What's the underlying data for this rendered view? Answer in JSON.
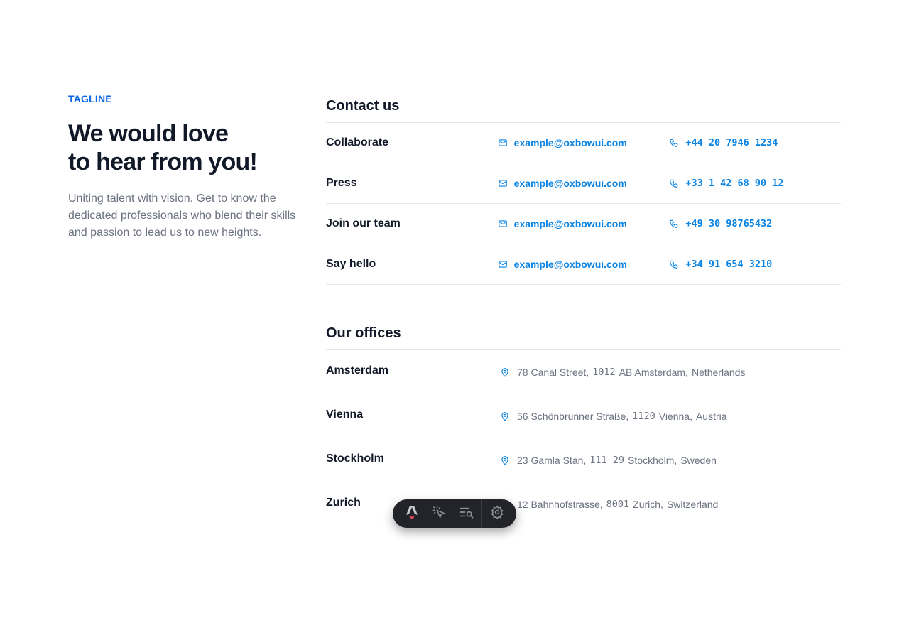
{
  "hero": {
    "tagline": "TAGLINE",
    "headline_line1": "We would love",
    "headline_line2": "to hear from you!",
    "intro": "Uniting talent with vision. Get to know the dedicated professionals who blend their skills and passion to lead us to new heights."
  },
  "contact": {
    "title": "Contact us",
    "rows": [
      {
        "label": "Collaborate",
        "email": "example@oxbowui.com",
        "phone": "+44 20 7946 1234"
      },
      {
        "label": "Press",
        "email": "example@oxbowui.com",
        "phone": "+33 1 42 68 90 12"
      },
      {
        "label": "Join our team",
        "email": "example@oxbowui.com",
        "phone": "+49 30 98765432"
      },
      {
        "label": "Say hello",
        "email": "example@oxbowui.com",
        "phone": "+34 91 654 3210"
      }
    ]
  },
  "offices": {
    "title": "Our offices",
    "rows": [
      {
        "city": "Amsterdam",
        "street": "78 Canal Street,",
        "postal": "1012",
        "postal_city": "AB Amsterdam,",
        "country": "Netherlands"
      },
      {
        "city": "Vienna",
        "street": "56 Schönbrunner Straße,",
        "postal": "1120",
        "postal_city": "Vienna,",
        "country": "Austria"
      },
      {
        "city": "Stockholm",
        "street": "23 Gamla Stan,",
        "postal": "111 29",
        "postal_city": "Stockholm,",
        "country": "Sweden"
      },
      {
        "city": "Zurich",
        "street": "12 Bahnhofstrasse,",
        "postal": "8001",
        "postal_city": "Zurich,",
        "country": "Switzerland"
      }
    ]
  },
  "toolbar": {
    "icons": [
      "astro-logo-icon",
      "cursor-inspect-icon",
      "search-list-icon",
      "gear-icon"
    ]
  },
  "colors": {
    "accent": "#0a84e4",
    "tagline": "#0a66e4",
    "text": "#111827",
    "muted": "#6b7280",
    "divider": "#e5e7eb",
    "toolbar_bg": "#232429"
  }
}
